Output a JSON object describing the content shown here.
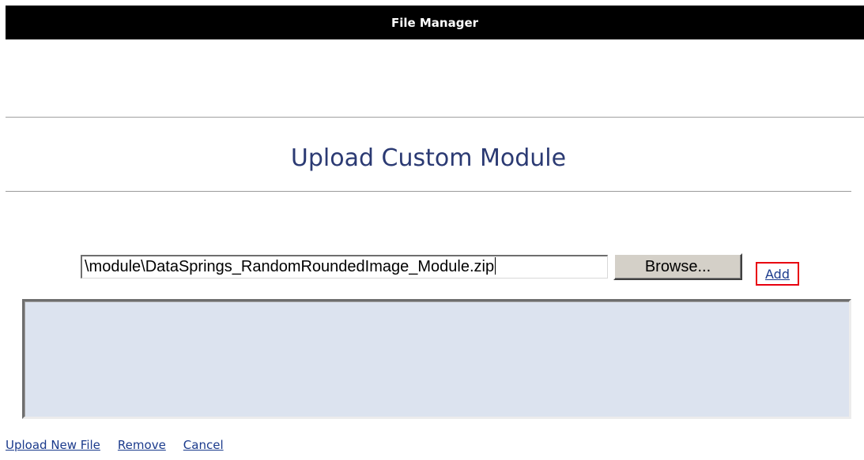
{
  "header": {
    "title": "File Manager"
  },
  "section": {
    "title": "Upload Custom Module"
  },
  "upload": {
    "file_path_value": "\\module\\DataSprings_RandomRoundedImage_Module.zip",
    "browse_label": "Browse...",
    "add_label": "Add"
  },
  "file_list": {
    "items": []
  },
  "actions": {
    "upload_new_label": "Upload New File",
    "remove_label": "Remove",
    "cancel_label": "Cancel"
  },
  "colors": {
    "titlebar_bg": "#000000",
    "heading_color": "#2b3a73",
    "link_color": "#1a3a8c",
    "highlight_border": "#e8000f",
    "list_bg": "#dce3ef"
  }
}
